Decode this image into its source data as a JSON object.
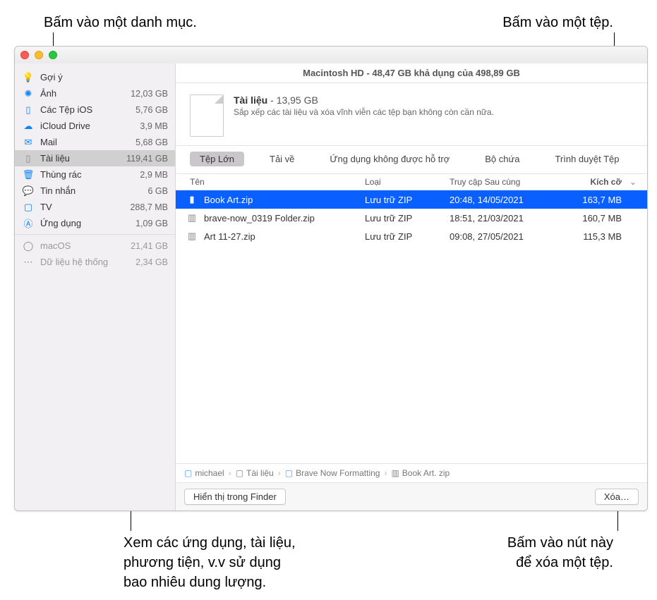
{
  "callouts": {
    "top_left": "Bấm vào một danh mục.",
    "top_right": "Bấm vào một tệp.",
    "bottom_left": "Xem các ứng dụng, tài liệu,\nphương tiện, v.v sử dụng\nbao nhiêu dung lượng.",
    "bottom_right": "Bấm vào nút này\nđể xóa một tệp."
  },
  "window_title": "Macintosh HD - 48,47 GB khả dụng của 498,89 GB",
  "sidebar": {
    "items": [
      {
        "icon": "lightbulb",
        "label": "Gợi ý",
        "size": "",
        "selected": false
      },
      {
        "icon": "atom",
        "label": "Ảnh",
        "size": "12,03 GB",
        "selected": false
      },
      {
        "icon": "phone",
        "label": "Các Tệp iOS",
        "size": "5,76 GB",
        "selected": false
      },
      {
        "icon": "cloud",
        "label": "iCloud Drive",
        "size": "3,9 MB",
        "selected": false
      },
      {
        "icon": "envelope",
        "label": "Mail",
        "size": "5,68 GB",
        "selected": false
      },
      {
        "icon": "doc",
        "label": "Tài liệu",
        "size": "119,41 GB",
        "selected": true
      },
      {
        "icon": "trash",
        "label": "Thùng rác",
        "size": "2,9 MB",
        "selected": false
      },
      {
        "icon": "bubble",
        "label": "Tin nhắn",
        "size": "6 GB",
        "selected": false
      },
      {
        "icon": "tv",
        "label": "TV",
        "size": "288,7 MB",
        "selected": false
      },
      {
        "icon": "app",
        "label": "Ứng dụng",
        "size": "1,09 GB",
        "selected": false
      }
    ],
    "system": [
      {
        "icon": "circle",
        "label": "macOS",
        "size": "21,41 GB"
      },
      {
        "icon": "dots",
        "label": "Dữ liệu hệ thống",
        "size": "2,34 GB"
      }
    ]
  },
  "detail": {
    "title": "Tài liệu",
    "title_size": "13,95 GB",
    "subtitle": "Sắp xếp các tài liệu và xóa vĩnh viễn các tệp bạn không còn cần nữa."
  },
  "tabs": [
    "Tệp Lớn",
    "Tải về",
    "Ứng dụng không được hỗ trợ",
    "Bộ chứa",
    "Trình duyệt Tệp"
  ],
  "columns": {
    "name": "Tên",
    "type": "Loại",
    "date": "Truy cập Sau cùng",
    "size": "Kích cỡ"
  },
  "rows": [
    {
      "name": "Book Art.zip",
      "type": "Lưu trữ ZIP",
      "date": "20:48, 14/05/2021",
      "size": "163,7 MB",
      "selected": true,
      "icon": "file"
    },
    {
      "name": "brave-now_0319 Folder.zip",
      "type": "Lưu trữ ZIP",
      "date": "18:51, 21/03/2021",
      "size": "160,7 MB",
      "selected": false,
      "icon": "zip"
    },
    {
      "name": "Art 11-27.zip",
      "type": "Lưu trữ ZIP",
      "date": "09:08, 27/05/2021",
      "size": "115,3 MB",
      "selected": false,
      "icon": "zip"
    }
  ],
  "path": [
    {
      "icon": "folder-blue",
      "label": "michael"
    },
    {
      "icon": "folder",
      "label": "Tài liệu"
    },
    {
      "icon": "folder",
      "label": "Brave Now Formatting"
    },
    {
      "icon": "zip",
      "label": "Book Art. zip"
    }
  ],
  "buttons": {
    "finder": "Hiển thị trong Finder",
    "delete": "Xóa…"
  }
}
